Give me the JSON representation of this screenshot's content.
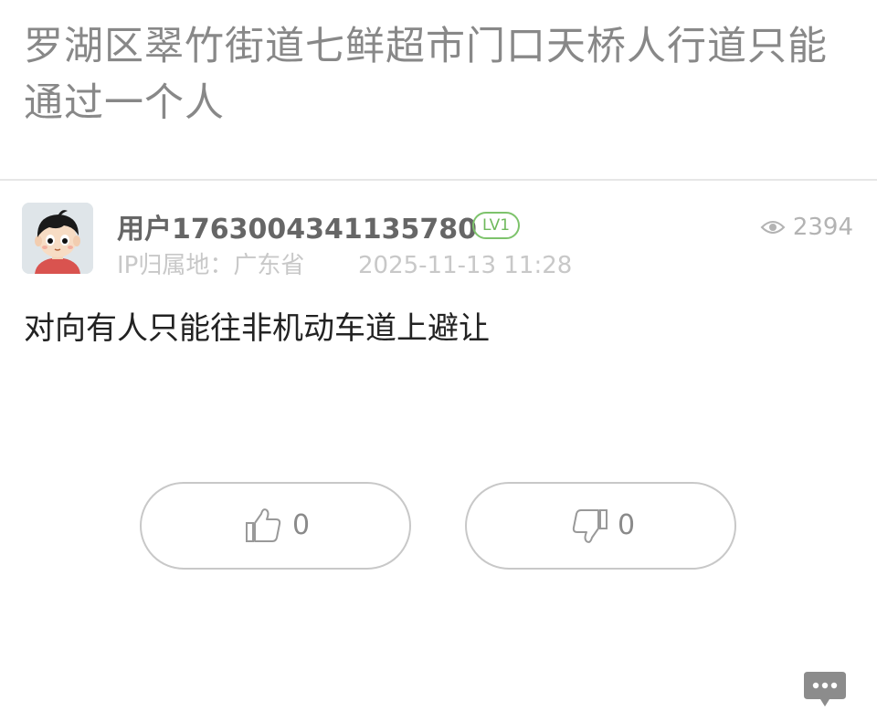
{
  "post": {
    "title": "罗湖区翠竹街道七鲜超市门口天桥人行道只能通过一个人",
    "body": "对向有人只能往非机动车道上避让"
  },
  "author": {
    "username": "用户1763004341135780",
    "level": "LV1",
    "ip_location": "IP归属地：广东省",
    "post_time": "2025-11-13 11:28"
  },
  "stats": {
    "views": "2394"
  },
  "votes": {
    "like_count": "0",
    "dislike_count": "0"
  },
  "icons": {
    "views": "eye-icon",
    "like": "thumbs-up-icon",
    "dislike": "thumbs-down-icon",
    "chat": "chat-bubble-icon",
    "avatar": "cartoon-boy-avatar"
  },
  "colors": {
    "title_text": "#888888",
    "level_badge": "#7dc36b",
    "meta_text": "#c8c8c8",
    "button_border": "#c8c8c8",
    "chat_fab": "#8c8c8c"
  }
}
